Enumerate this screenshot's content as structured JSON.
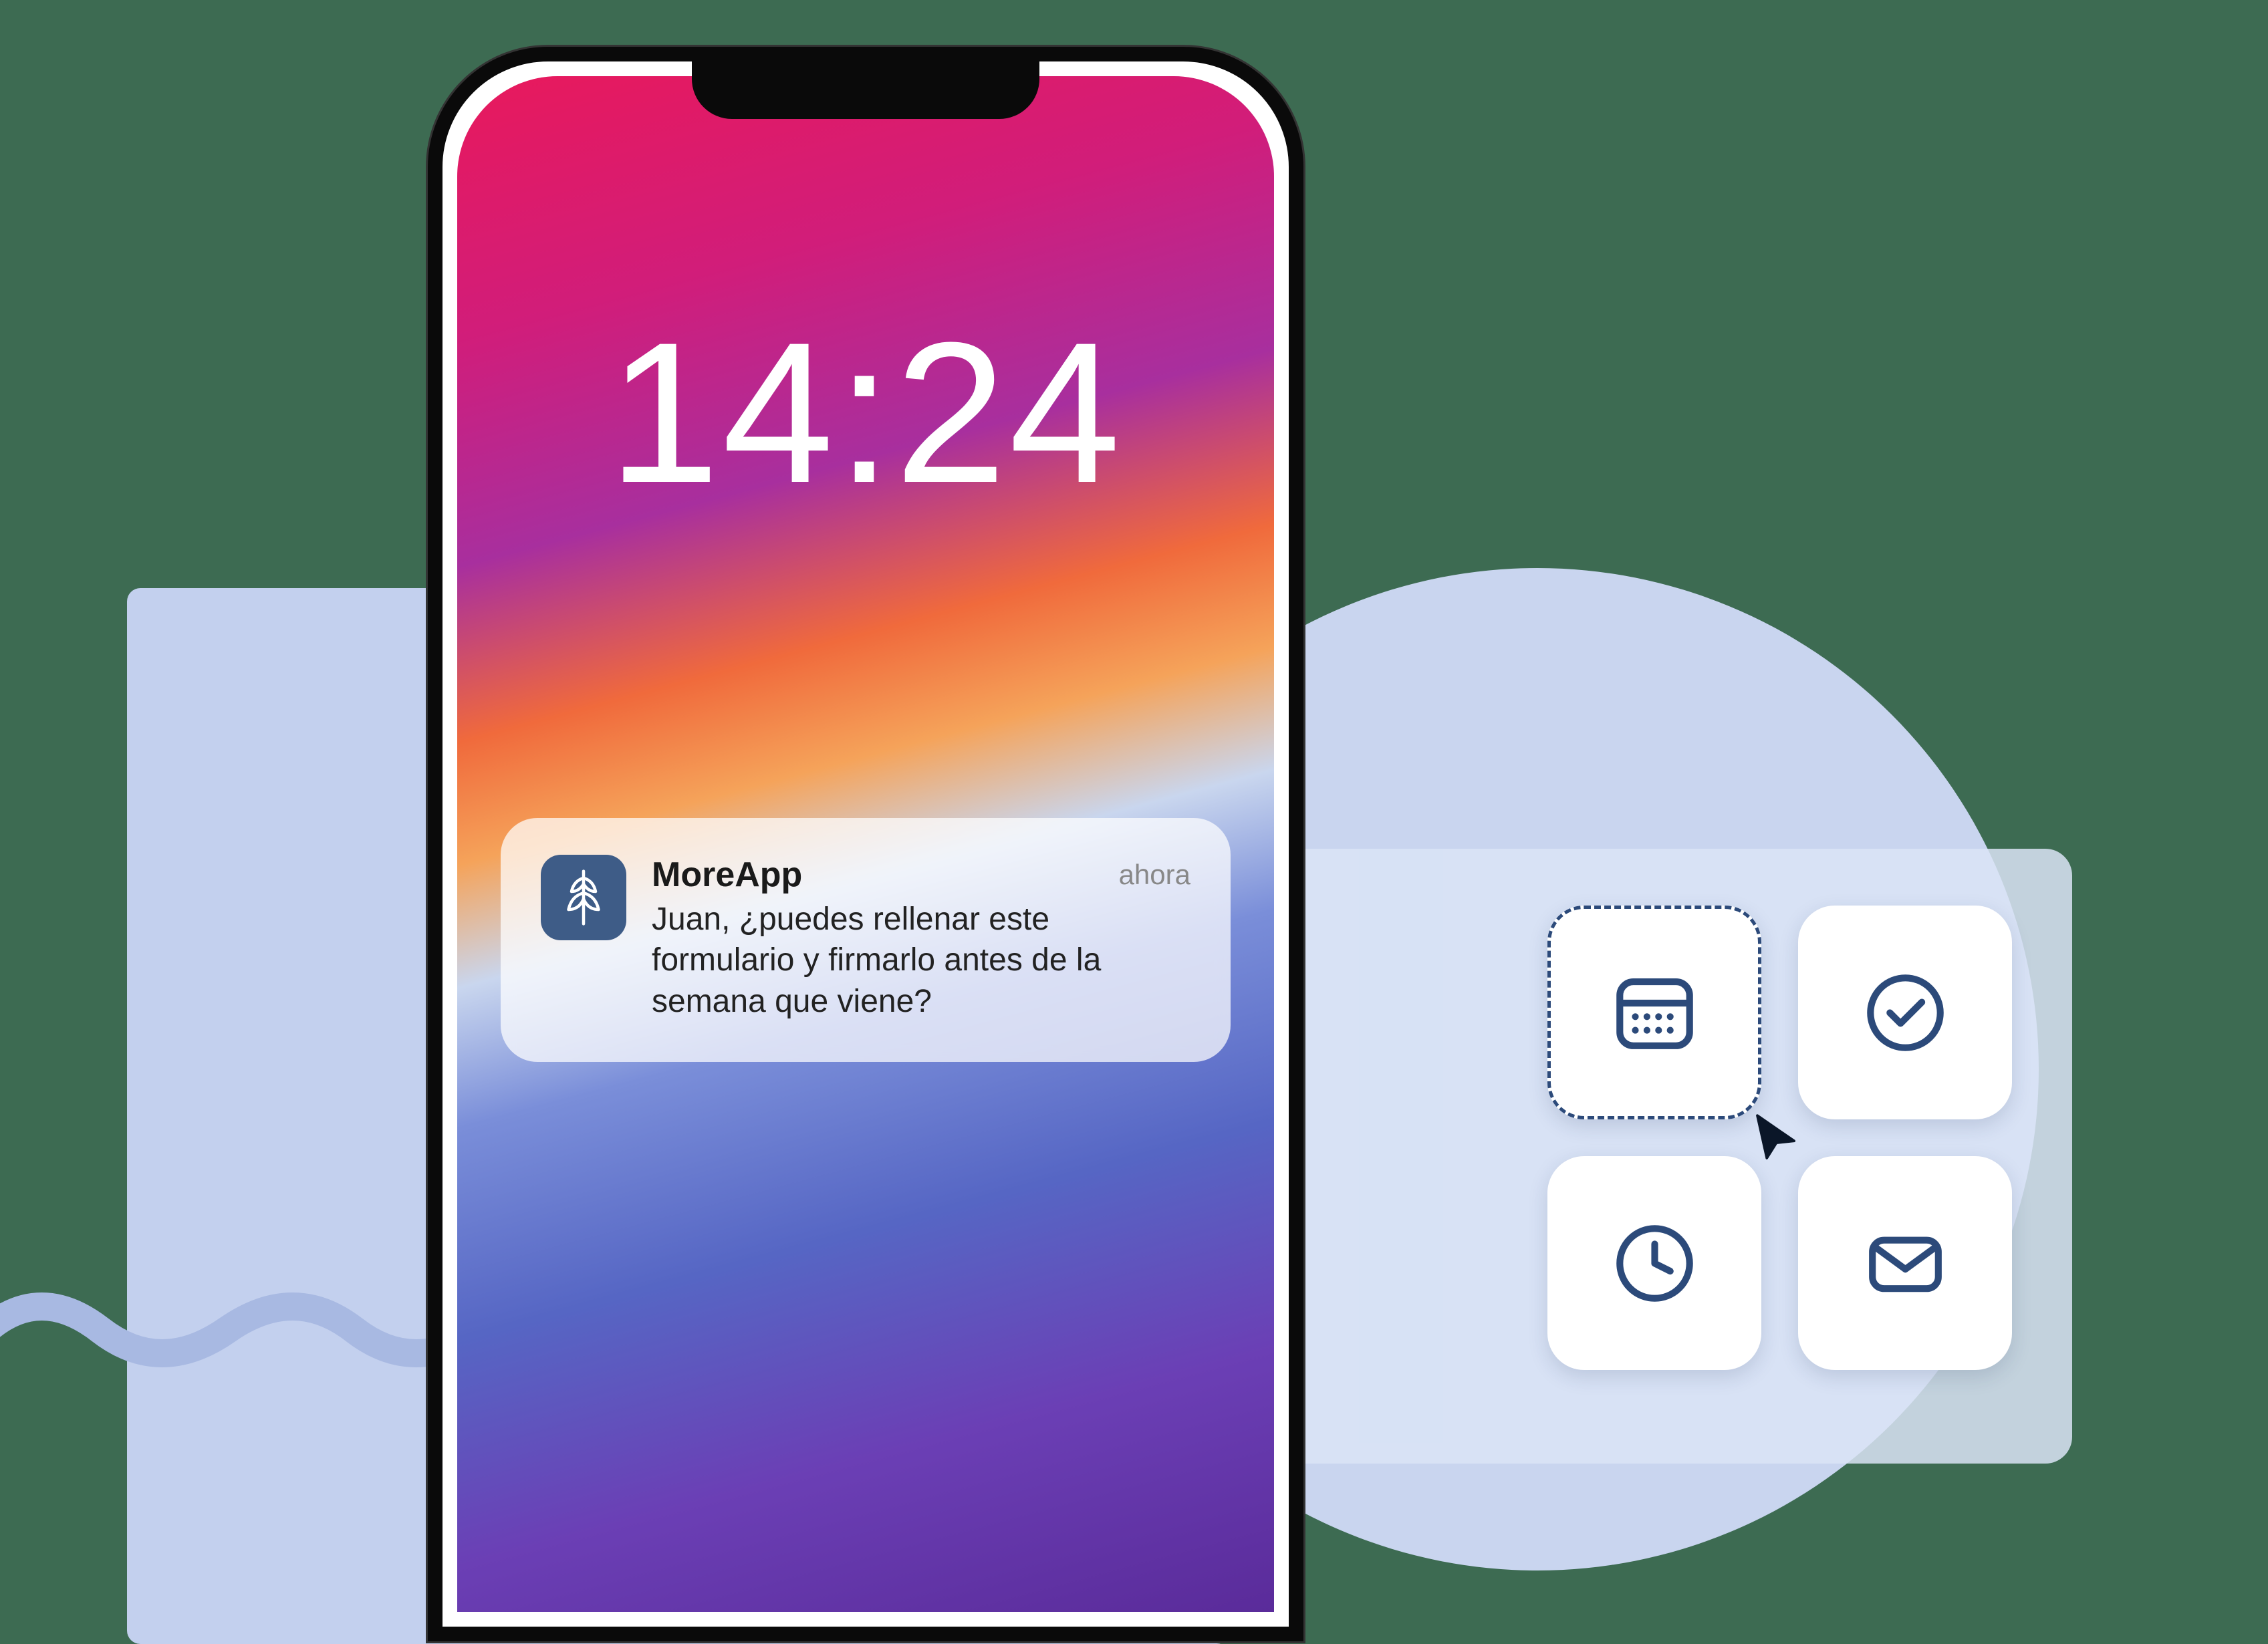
{
  "clock": "14:24",
  "notification": {
    "app": "MoreApp",
    "time": "ahora",
    "message": "Juan, ¿puedes rellenar este formulario y firmarlo antes de la semana que viene?"
  },
  "widgets": {
    "calendar": "calendar",
    "check": "check",
    "clock": "clock",
    "mail": "mail"
  },
  "colors": {
    "accent": "#2c4a7a",
    "panel": "#dae4f6",
    "background": "#3d6b52"
  }
}
